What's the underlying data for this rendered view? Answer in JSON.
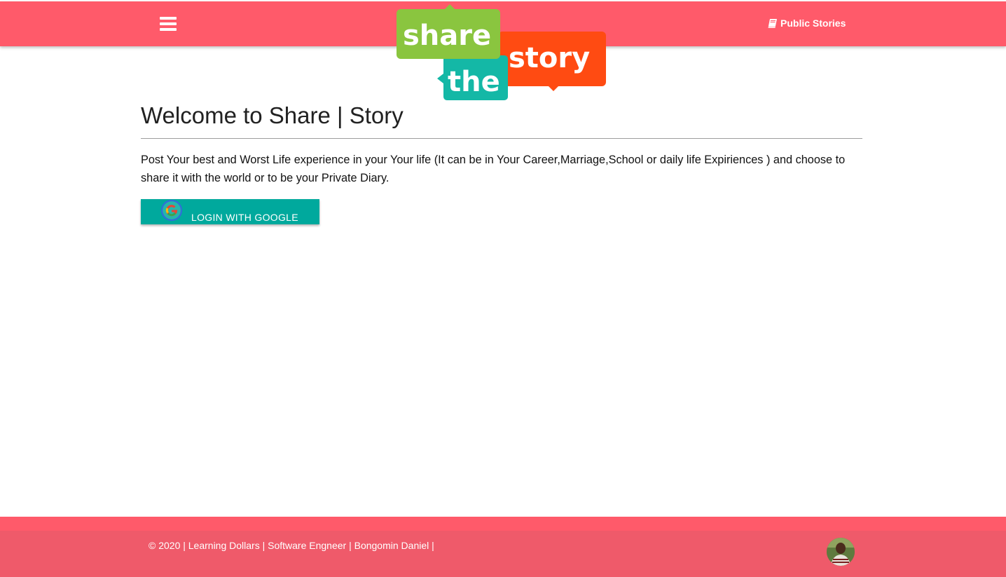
{
  "navbar": {
    "menu_icon": "hamburger-icon",
    "logo": {
      "line1": "share",
      "line2": "the",
      "line3": "story"
    },
    "public_stories": {
      "icon": "book-icon",
      "label": "Public Stories"
    }
  },
  "main": {
    "title": "Welcome to Share | Story",
    "intro": "Post Your best and Worst Life experience in your Your life (It can be in Your Career,Marriage,School or daily life Expiriences ) and choose to share it with the world or to be your Private Diary.",
    "login_button": {
      "icon": "google-icon",
      "label": "LOGIN WITH GOOGLE"
    }
  },
  "footer": {
    "text": "© 2020 | Learning Dollars | Software Engneer | Bongomin Daniel |",
    "avatar_icon": "profile-avatar"
  },
  "colors": {
    "brand": "#ff5a6a",
    "button": "#00a99d",
    "logo_green": "#8ac53f",
    "logo_teal": "#14b8a6",
    "logo_orange": "#ff4b12"
  }
}
